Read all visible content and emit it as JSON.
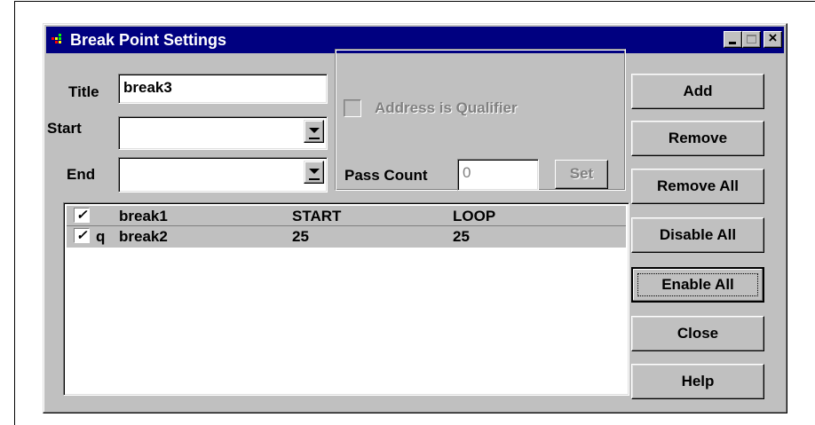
{
  "window": {
    "title": "Break Point Settings",
    "controls": {
      "minimize": "_",
      "maximize": "□",
      "close": "×"
    }
  },
  "form": {
    "title_label": "Title",
    "title_value": "break3",
    "start_label": "Start",
    "start_value": "",
    "end_label": "End",
    "end_value": ""
  },
  "qualifier": {
    "checkbox_label": "Address is Qualifier",
    "checked": false,
    "enabled": false,
    "pass_count_label": "Pass Count",
    "pass_count_value": "0",
    "set_label": "Set"
  },
  "breakpoints": [
    {
      "checked": true,
      "check_glyph": "✓",
      "qualifier": "",
      "name": "break1",
      "start": "START",
      "end": "LOOP"
    },
    {
      "checked": true,
      "check_glyph": "✓",
      "qualifier": "q",
      "name": "break2",
      "start": "25",
      "end": "25"
    }
  ],
  "buttons": {
    "add": "Add",
    "remove": "Remove",
    "remove_all": "Remove All",
    "disable_all": "Disable All",
    "enable_all": "Enable All",
    "close": "Close",
    "help": "Help"
  },
  "colors": {
    "titlebar": "#000080",
    "face": "#c0c0c0",
    "shadow": "#808080",
    "highlight": "#ffffff"
  },
  "icons": {
    "app": "breakpoint-app-icon",
    "combo": "chevron-down-icon"
  }
}
